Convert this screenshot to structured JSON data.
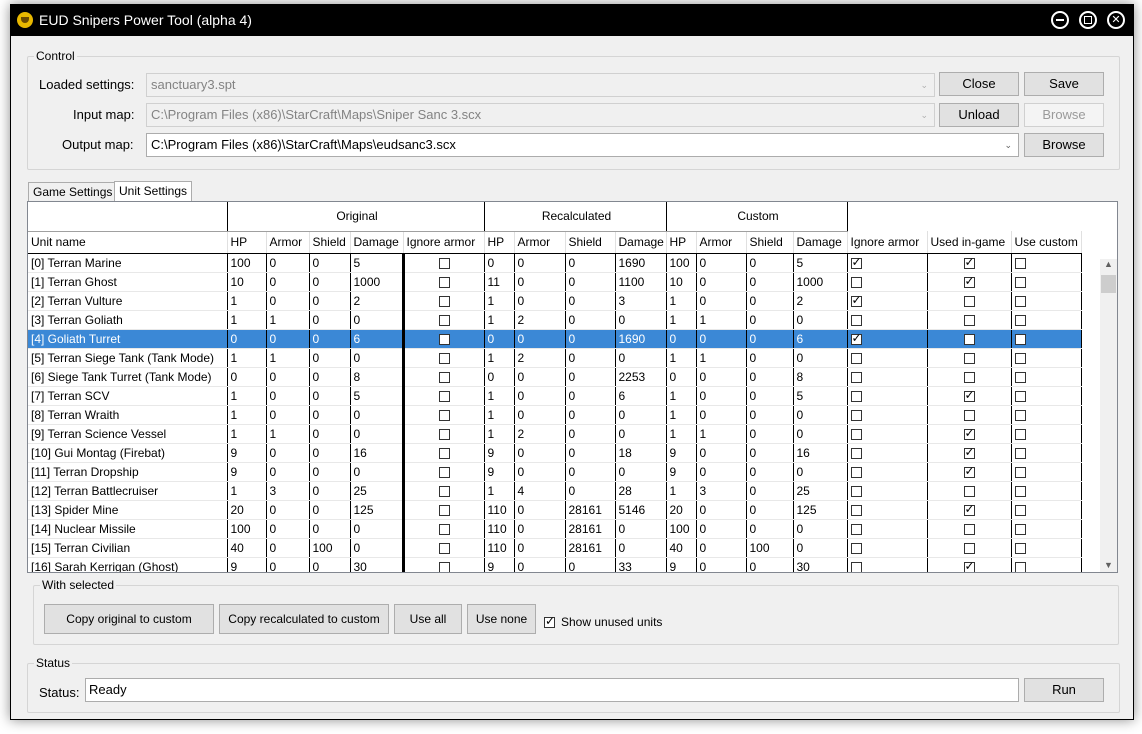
{
  "window": {
    "title": "EUD Snipers Power Tool (alpha 4)"
  },
  "control": {
    "group_label": "Control",
    "loaded_settings_label": "Loaded settings:",
    "loaded_settings_value": "sanctuary3.spt",
    "input_map_label": "Input map:",
    "input_map_value": "C:\\Program Files (x86)\\StarCraft\\Maps\\Sniper Sanc 3.scx",
    "output_map_label": "Output map:",
    "output_map_value": "C:\\Program Files (x86)\\StarCraft\\Maps\\eudsanc3.scx",
    "close_label": "Close",
    "save_label": "Save",
    "unload_label": "Unload",
    "browse_input_label": "Browse",
    "browse_output_label": "Browse"
  },
  "tabs": [
    {
      "label": "Game Settings"
    },
    {
      "label": "Unit Settings"
    }
  ],
  "grid": {
    "groups": {
      "original": "Original",
      "recalculated": "Recalculated",
      "custom": "Custom"
    },
    "columns": [
      "Unit name",
      "HP",
      "Armor",
      "Shield",
      "Damage",
      "Ignore armor",
      "HP",
      "Armor",
      "Shield",
      "Damage",
      "HP",
      "Armor",
      "Shield",
      "Damage",
      "Ignore armor",
      "Used in-game",
      "Use custom"
    ],
    "rows": [
      {
        "name": "[0] Terran Marine",
        "o": [
          "100",
          "0",
          "0",
          "5"
        ],
        "oi": false,
        "r": [
          "0",
          "0",
          "0",
          "1690"
        ],
        "c": [
          "100",
          "0",
          "0",
          "5"
        ],
        "ci": true,
        "used": true,
        "uc": false
      },
      {
        "name": "[1] Terran Ghost",
        "o": [
          "10",
          "0",
          "0",
          "1000"
        ],
        "oi": false,
        "r": [
          "11",
          "0",
          "0",
          "1100"
        ],
        "c": [
          "10",
          "0",
          "0",
          "1000"
        ],
        "ci": false,
        "used": true,
        "uc": false
      },
      {
        "name": "[2] Terran Vulture",
        "o": [
          "1",
          "0",
          "0",
          "2"
        ],
        "oi": false,
        "r": [
          "1",
          "0",
          "0",
          "3"
        ],
        "c": [
          "1",
          "0",
          "0",
          "2"
        ],
        "ci": true,
        "used": false,
        "uc": false
      },
      {
        "name": "[3] Terran Goliath",
        "o": [
          "1",
          "1",
          "0",
          "0"
        ],
        "oi": false,
        "r": [
          "1",
          "2",
          "0",
          "0"
        ],
        "c": [
          "1",
          "1",
          "0",
          "0"
        ],
        "ci": false,
        "used": false,
        "uc": false
      },
      {
        "name": "[4] Goliath Turret",
        "o": [
          "0",
          "0",
          "0",
          "6"
        ],
        "oi": false,
        "r": [
          "0",
          "0",
          "0",
          "1690"
        ],
        "c": [
          "0",
          "0",
          "0",
          "6"
        ],
        "ci": true,
        "used": false,
        "uc": false,
        "sel": true
      },
      {
        "name": "[5] Terran Siege Tank (Tank Mode)",
        "o": [
          "1",
          "1",
          "0",
          "0"
        ],
        "oi": false,
        "r": [
          "1",
          "2",
          "0",
          "0"
        ],
        "c": [
          "1",
          "1",
          "0",
          "0"
        ],
        "ci": false,
        "used": false,
        "uc": false
      },
      {
        "name": "[6] Siege Tank Turret (Tank Mode)",
        "o": [
          "0",
          "0",
          "0",
          "8"
        ],
        "oi": false,
        "r": [
          "0",
          "0",
          "0",
          "2253"
        ],
        "c": [
          "0",
          "0",
          "0",
          "8"
        ],
        "ci": false,
        "used": false,
        "uc": false
      },
      {
        "name": "[7] Terran SCV",
        "o": [
          "1",
          "0",
          "0",
          "5"
        ],
        "oi": false,
        "r": [
          "1",
          "0",
          "0",
          "6"
        ],
        "c": [
          "1",
          "0",
          "0",
          "5"
        ],
        "ci": false,
        "used": true,
        "uc": false
      },
      {
        "name": "[8] Terran Wraith",
        "o": [
          "1",
          "0",
          "0",
          "0"
        ],
        "oi": false,
        "r": [
          "1",
          "0",
          "0",
          "0"
        ],
        "c": [
          "1",
          "0",
          "0",
          "0"
        ],
        "ci": false,
        "used": false,
        "uc": false
      },
      {
        "name": "[9] Terran Science Vessel",
        "o": [
          "1",
          "1",
          "0",
          "0"
        ],
        "oi": false,
        "r": [
          "1",
          "2",
          "0",
          "0"
        ],
        "c": [
          "1",
          "1",
          "0",
          "0"
        ],
        "ci": false,
        "used": true,
        "uc": false
      },
      {
        "name": "[10] Gui Montag (Firebat)",
        "o": [
          "9",
          "0",
          "0",
          "16"
        ],
        "oi": false,
        "r": [
          "9",
          "0",
          "0",
          "18"
        ],
        "c": [
          "9",
          "0",
          "0",
          "16"
        ],
        "ci": false,
        "used": true,
        "uc": false
      },
      {
        "name": "[11] Terran Dropship",
        "o": [
          "9",
          "0",
          "0",
          "0"
        ],
        "oi": false,
        "r": [
          "9",
          "0",
          "0",
          "0"
        ],
        "c": [
          "9",
          "0",
          "0",
          "0"
        ],
        "ci": false,
        "used": true,
        "uc": false
      },
      {
        "name": "[12] Terran Battlecruiser",
        "o": [
          "1",
          "3",
          "0",
          "25"
        ],
        "oi": false,
        "r": [
          "1",
          "4",
          "0",
          "28"
        ],
        "c": [
          "1",
          "3",
          "0",
          "25"
        ],
        "ci": false,
        "used": false,
        "uc": false
      },
      {
        "name": "[13] Spider Mine",
        "o": [
          "20",
          "0",
          "0",
          "125"
        ],
        "oi": false,
        "r": [
          "110",
          "0",
          "28161",
          "5146"
        ],
        "c": [
          "20",
          "0",
          "0",
          "125"
        ],
        "ci": false,
        "used": true,
        "uc": false
      },
      {
        "name": "[14] Nuclear Missile",
        "o": [
          "100",
          "0",
          "0",
          "0"
        ],
        "oi": false,
        "r": [
          "110",
          "0",
          "28161",
          "0"
        ],
        "c": [
          "100",
          "0",
          "0",
          "0"
        ],
        "ci": false,
        "used": false,
        "uc": false
      },
      {
        "name": "[15] Terran Civilian",
        "o": [
          "40",
          "0",
          "100",
          "0"
        ],
        "oi": false,
        "r": [
          "110",
          "0",
          "28161",
          "0"
        ],
        "c": [
          "40",
          "0",
          "100",
          "0"
        ],
        "ci": false,
        "used": false,
        "uc": false
      },
      {
        "name": "[16] Sarah Kerrigan (Ghost)",
        "o": [
          "9",
          "0",
          "0",
          "30"
        ],
        "oi": false,
        "r": [
          "9",
          "0",
          "0",
          "33"
        ],
        "c": [
          "9",
          "0",
          "0",
          "30"
        ],
        "ci": false,
        "used": true,
        "uc": false
      }
    ]
  },
  "with_selected": {
    "group_label": "With selected",
    "copy_original_label": "Copy original to custom",
    "copy_recalculated_label": "Copy recalculated to custom",
    "use_all_label": "Use all",
    "use_none_label": "Use none",
    "show_unused_label": "Show unused units",
    "show_unused_checked": true
  },
  "status": {
    "group_label": "Status",
    "status_label": "Status:",
    "status_value": "Ready",
    "run_label": "Run"
  },
  "colors": {
    "selection": "#3b88d6",
    "titlebar": "#000000"
  }
}
